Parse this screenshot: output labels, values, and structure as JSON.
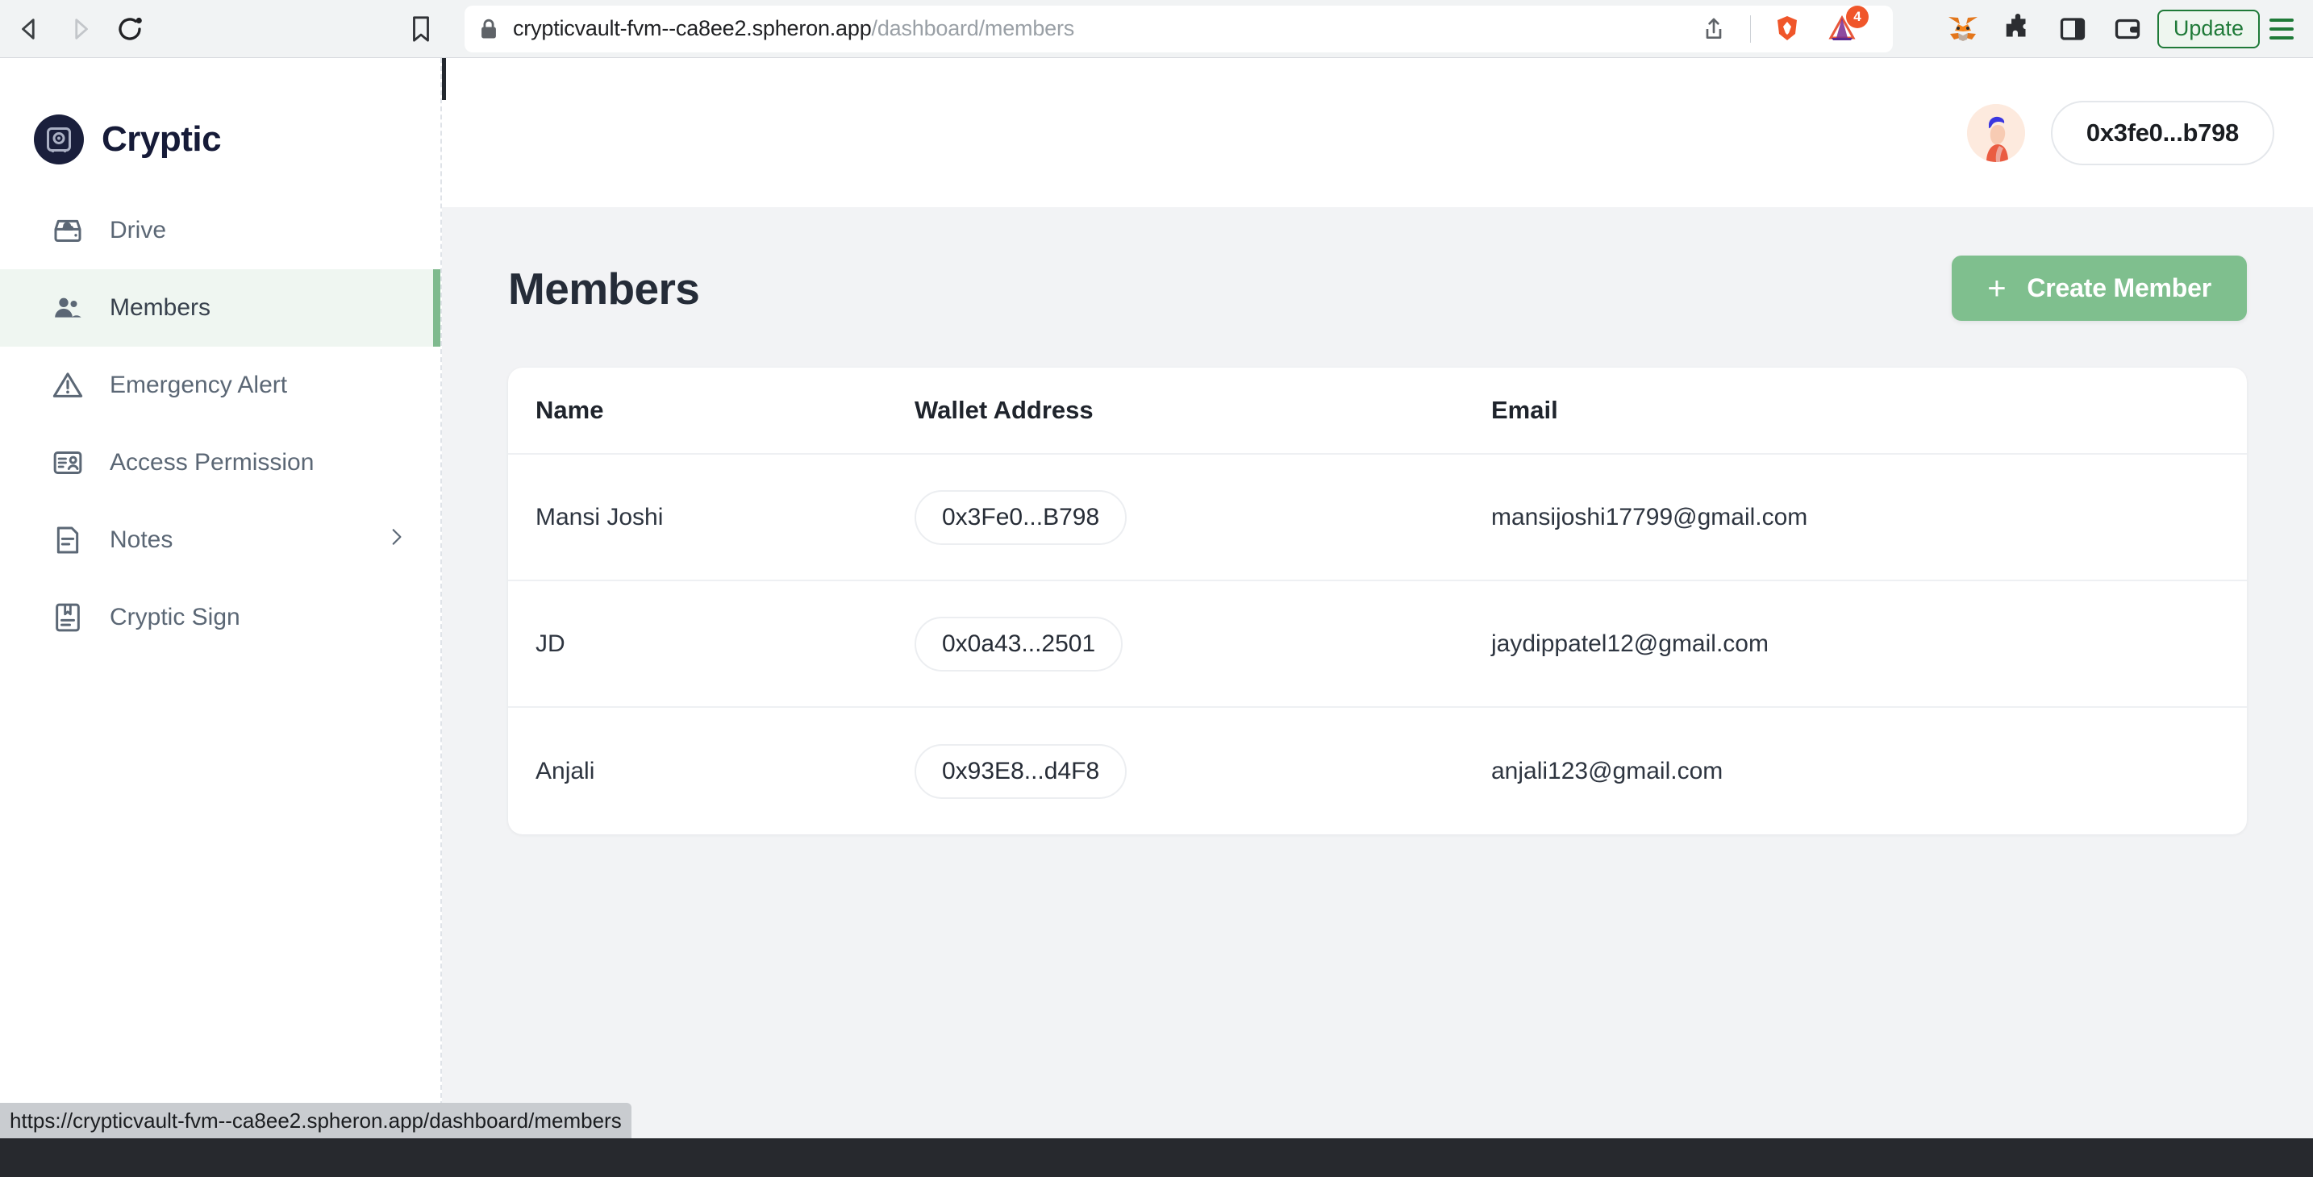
{
  "browser": {
    "back_label": "Back",
    "forward_label": "Forward",
    "reload_label": "Reload",
    "bookmark_label": "Bookmark",
    "url_domain": "crypticvault-fvm--ca8ee2.spheron.app",
    "url_path": "/dashboard/members",
    "share_label": "Share",
    "brave_shields_label": "Brave Shields",
    "brave_rewards_label": "Brave Rewards",
    "brave_rewards_badge": "4",
    "metamask_label": "MetaMask",
    "extensions_label": "Extensions",
    "sidebar_toggle_label": "Sidebar",
    "wallet_label": "Brave Wallet",
    "update_label": "Update",
    "menu_label": "Menu",
    "status_url": "https://crypticvault-fvm--ca8ee2.spheron.app/dashboard/members"
  },
  "sidebar": {
    "brand": "Cryptic",
    "items": [
      {
        "label": "Drive",
        "icon": "drive-icon",
        "active": false,
        "chevron": false
      },
      {
        "label": "Members",
        "icon": "members-icon",
        "active": true,
        "chevron": false
      },
      {
        "label": "Emergency Alert",
        "icon": "warning-icon",
        "active": false,
        "chevron": false
      },
      {
        "label": "Access Permission",
        "icon": "access-permission-icon",
        "active": false,
        "chevron": false
      },
      {
        "label": "Notes",
        "icon": "notes-icon",
        "active": false,
        "chevron": true
      },
      {
        "label": "Cryptic Sign",
        "icon": "cryptic-sign-icon",
        "active": false,
        "chevron": false
      }
    ]
  },
  "topbar": {
    "wallet_address": "0x3fe0...b798",
    "avatar_label": "User avatar"
  },
  "main": {
    "title": "Members",
    "create_button": "Create Member",
    "create_button_plus": "+",
    "table": {
      "columns": [
        "Name",
        "Wallet Address",
        "Email"
      ],
      "rows": [
        {
          "name": "Mansi Joshi",
          "wallet": "0x3Fe0...B798",
          "email": "mansijoshi17799@gmail.com"
        },
        {
          "name": "JD",
          "wallet": "0x0a43...2501",
          "email": "jaydippatel12@gmail.com"
        },
        {
          "name": "Anjali",
          "wallet": "0x93E8...d4F8",
          "email": "anjali123@gmail.com"
        }
      ]
    }
  },
  "colors": {
    "accent_green": "#7fbf8e",
    "active_bg": "#eff6f1",
    "main_bg": "#f2f3f5",
    "brand_navy": "#161b38",
    "update_green": "#1f7a38"
  }
}
